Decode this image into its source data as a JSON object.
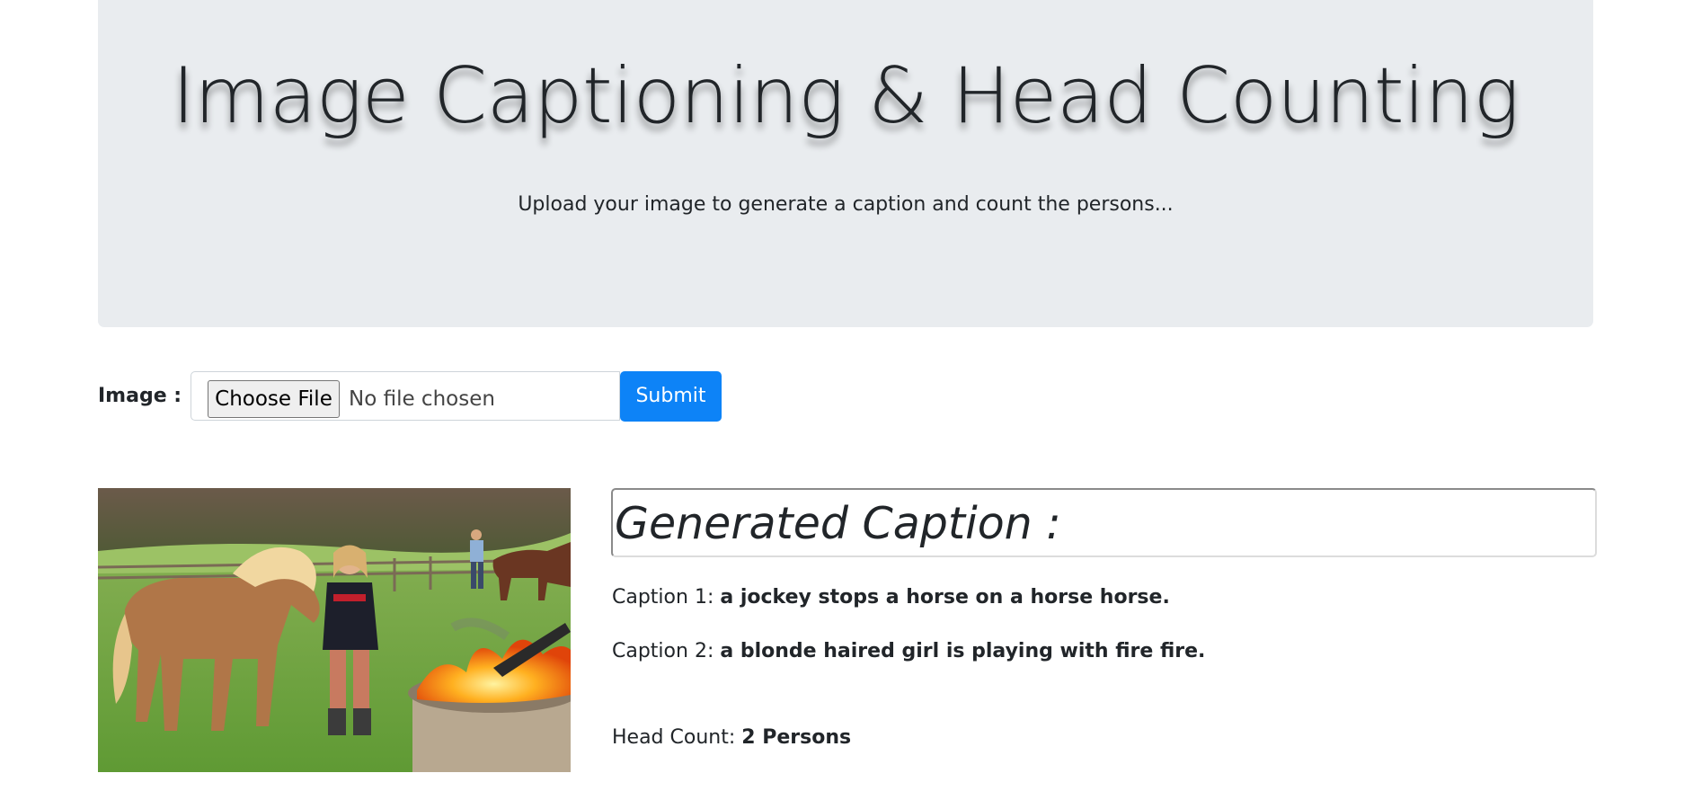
{
  "header": {
    "title": "Image Captioning & Head Counting",
    "subtitle": "Upload your image to generate a caption and count the persons..."
  },
  "form": {
    "label": "Image :",
    "choose_file_label": "Choose File",
    "no_file_text": "No file chosen",
    "submit_label": "Submit"
  },
  "results": {
    "heading": "Generated Caption :",
    "captions": [
      {
        "label": "Caption 1:",
        "text": "a jockey stops a horse on a horse horse."
      },
      {
        "label": "Caption 2:",
        "text": "a blonde haired girl is playing with fire fire."
      }
    ],
    "head_count_label": "Head Count:",
    "head_count_value": "2 Persons"
  },
  "colors": {
    "jumbotron_bg": "#e9ecef",
    "primary_button": "#0d83f7",
    "text": "#212529"
  }
}
